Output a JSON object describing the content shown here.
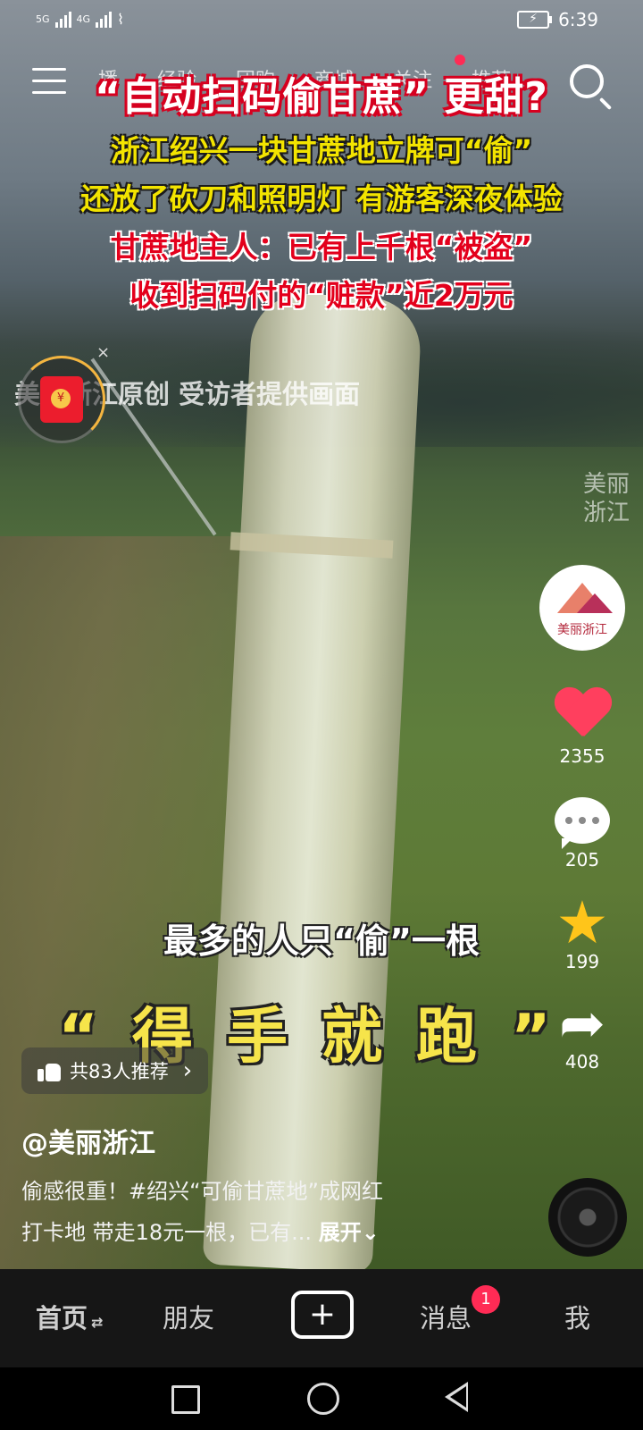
{
  "status_bar": {
    "signal_left": "5G",
    "signal_right": "4G",
    "time": "6:39"
  },
  "top_nav": {
    "tabs": [
      "播",
      "经验",
      "团购",
      "商城",
      "关注",
      "推荐"
    ]
  },
  "headline": {
    "title": "“自动扫码偷甘蔗” 更甜?",
    "line1": "浙江绍兴一块甘蔗地立牌可“偷”",
    "line2": "还放了砍刀和照明灯 有游客深夜体验",
    "line3": "甘蔗地主人：已有上千根“被盗”",
    "line4": "收到扫码付的“赃款”近2万元"
  },
  "video": {
    "source_text": "美丽浙江原创 受访者提供画面",
    "watermark": "美丽浙江",
    "caption_top": "最多的人只“偷”一根",
    "caption_bottom": "“得手就跑”"
  },
  "red_packet": {
    "coin_symbol": "¥",
    "close": "×"
  },
  "creator": {
    "avatar_text": "美丽浙江"
  },
  "actions": {
    "likes": "2355",
    "comments": "205",
    "favorites": "199",
    "shares": "408"
  },
  "recommend": {
    "label": "共83人推荐",
    "chevron": "›"
  },
  "post": {
    "author": "@美丽浙江",
    "desc_line1": "偷感很重！#绍兴“可偷甘蔗地”成网红",
    "desc_line2": "打卡地 带走18元一根，已有...",
    "expand": "展开⌄"
  },
  "bottom_tabs": {
    "home": "首页",
    "home_switch": "⇄",
    "friends": "朋友",
    "plus": "+",
    "messages": "消息",
    "messages_badge": "1",
    "me": "我"
  },
  "colors": {
    "accent_red": "#ff2b55",
    "like_red": "#ff3f5e",
    "star_yellow": "#ffc51a",
    "caption_yellow": "#f6e44a"
  }
}
